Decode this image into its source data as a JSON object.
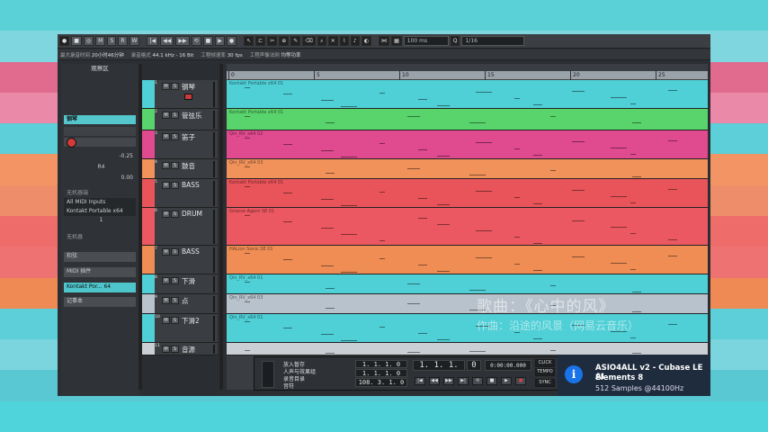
{
  "background": {
    "stripes": [
      "#5ad1d6",
      "#7fd6df",
      "#e06b8f",
      "#eb8aa8",
      "#5ccfd8",
      "#f29463",
      "#ee8d6a",
      "#ee6d6a",
      "#ef7272",
      "#f08a55",
      "#5ccfd8",
      "#7ad5de",
      "#59c8d3",
      "#4fd4dc"
    ]
  },
  "toolbar": {
    "buttons": [
      "M",
      "S",
      "R",
      "W"
    ],
    "zoom_value": "100 ms",
    "quantize_value": "1/16"
  },
  "infobar": {
    "items": [
      {
        "label": "最大录音时间",
        "value": "20小时46分钟"
      },
      {
        "label": "录音格式",
        "value": "44.1 kHz - 16 Bit"
      },
      {
        "label": "工程帧速率",
        "value": "30 fps"
      },
      {
        "label": "工程声像法则",
        "value": "均等功率"
      }
    ]
  },
  "inspector": {
    "title": "观察区",
    "track_name": "钢琴",
    "volume": "-0.25",
    "pan": "R4",
    "delay": "0.00",
    "input_label": "无机器端",
    "midi_input": "All MIDI Inputs",
    "instrument": "Kontakt Portable x64",
    "channel": "1",
    "program_label": "无机器",
    "sections": [
      "和弦",
      "MIDI 插件",
      "Kontakt Por... 64",
      "记事本"
    ]
  },
  "tracks": [
    {
      "num": "1",
      "name": "钢琴",
      "color": "#4fcfd6",
      "part": "Kontakt Portable x64 01"
    },
    {
      "num": "2",
      "name": "管弦乐",
      "color": "#59d36b",
      "part": "Kontakt Portable x64 01"
    },
    {
      "num": "3",
      "name": "笛子",
      "color": "#e04a8f",
      "part": "Qin_RV_x64 02"
    },
    {
      "num": "4",
      "name": "鼓音",
      "color": "#f0925a",
      "part": "Qin_RV_x64 03"
    },
    {
      "num": "5",
      "name": "BASS",
      "color": "#e9545a",
      "part": "Kontakt Portable x64 01"
    },
    {
      "num": "6",
      "name": "DRUM",
      "color": "#ec5862",
      "part": "Groove Agent SE 01"
    },
    {
      "num": "7",
      "name": "BASS",
      "color": "#ef8d55",
      "part": "HALion Sonic SE 01"
    },
    {
      "num": "8",
      "name": "下滑",
      "color": "#4fcfd6",
      "part": "Qin_RV_x64 01"
    },
    {
      "num": "9",
      "name": "点",
      "color": "#b8c2cc",
      "part": "Qin_RV_x64 03"
    },
    {
      "num": "10",
      "name": "下滑2",
      "color": "#4fcfd6",
      "part": "Qin_RV_x64 01"
    },
    {
      "num": "11",
      "name": "音源",
      "color": "#c9cfd5",
      "part": ""
    }
  ],
  "ruler": {
    "ticks": [
      "0",
      "5",
      "10",
      "15",
      "20",
      "25"
    ]
  },
  "transport": {
    "labels": [
      "放入暂存",
      "人声与效果组",
      "录音目录",
      "音符"
    ],
    "left_locator": "1. 1. 1. 0",
    "right_locator": "1. 1. 1. 0",
    "tempo": "108. 3. 1. 0",
    "position": "1. 1. 1.",
    "position_ticks": "0",
    "time": "0:00:00.000",
    "click": "CLICK",
    "tempo_label": "TEMPO",
    "sync": "SYNC"
  },
  "lyrics": {
    "song": "歌曲：《心中的风》",
    "composer": "作曲：沿途的风景（网易云音乐）"
  },
  "toast": {
    "title": "ASIO4ALL v2 - Cubase LE AI",
    "subtitle": "Elements 8",
    "detail": "512 Samples    @44100Hz"
  }
}
